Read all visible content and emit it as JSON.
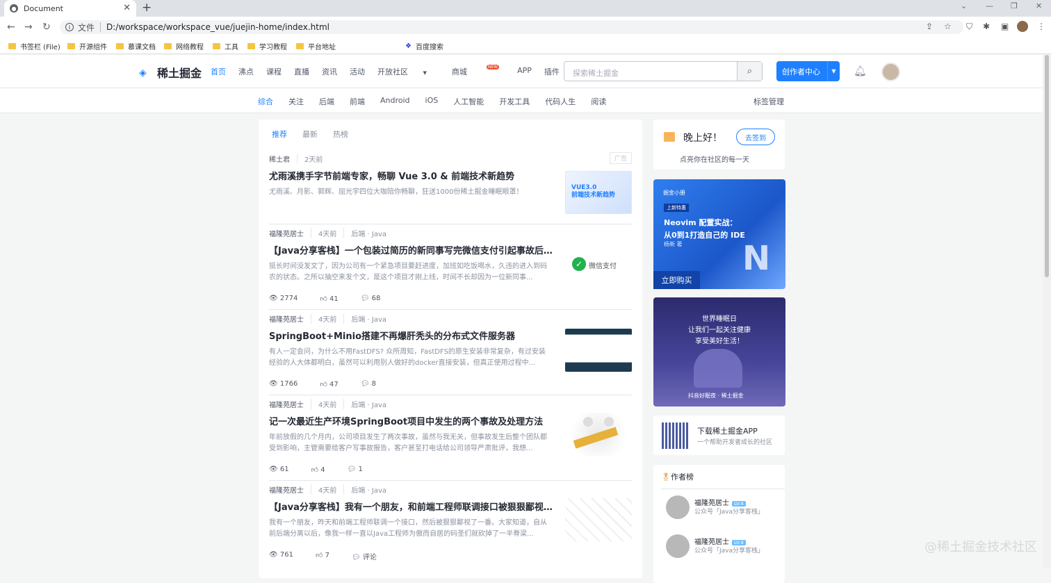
{
  "browser": {
    "tab_title": "Document",
    "url_prefix": "文件",
    "url": "D:/workspace/workspace_vue/juejin-home/index.html",
    "bookmarks": [
      "书签栏 (File)",
      "开源组件",
      "慕课文档",
      "网络教程",
      "工具",
      "学习教程",
      "平台地址",
      "百度搜索"
    ]
  },
  "header": {
    "logo": "稀土掘金",
    "nav": [
      "首页",
      "沸点",
      "课程",
      "直播",
      "资讯",
      "活动",
      "开放社区",
      "商城",
      "APP",
      "插件"
    ],
    "new_badge": "NEW",
    "search_placeholder": "探索稀土掘金",
    "creator_button": "创作者中心"
  },
  "subnav": {
    "items": [
      "综合",
      "关注",
      "后端",
      "前端",
      "Android",
      "iOS",
      "人工智能",
      "开发工具",
      "代码人生",
      "阅读"
    ],
    "tag_manage": "标签管理"
  },
  "feed": {
    "tabs": [
      "推荐",
      "最新",
      "热榜"
    ],
    "entries": [
      {
        "author": "稀土君",
        "time": "2天前",
        "tags": "",
        "ad": "广告",
        "title": "尤雨溪携手字节前端专家，畅聊 Vue 3.0 & 前端技术新趋势",
        "abstract": "尤雨溪、月影、郭辉、屈光宇四位大咖陪你畅聊，狂送1000份稀土掘金睡眠眼罩！",
        "views": "",
        "likes": "",
        "comments": ""
      },
      {
        "author": "福隆苑居士",
        "time": "4天前",
        "tags": "后端 · Java",
        "ad": "",
        "title": "【Java分享客栈】一个包装过简历的新同事写完微信支付引起事故后果...",
        "abstract": "挺长时间没发文了，因为公司有一个紧急项目要赶进度，加班如吃饭喝水，久违的进入到码农的状态。之所以抽空来发个文，是这个项目才刚上线，时间不长却因为一位新同事...",
        "views": "2774",
        "likes": "41",
        "comments": "68"
      },
      {
        "author": "福隆苑居士",
        "time": "4天前",
        "tags": "后端 · Java",
        "ad": "",
        "title": "SpringBoot+Minio搭建不再爆肝秃头的分布式文件服务器",
        "abstract": "有人一定会问，为什么不用FastDFS? 众所周知，FastDFS的原生安装非常复杂，有过安装经验的人大体都明白，虽然可以利用别人做好的docker直接安装，但真正使用过程中...",
        "views": "1766",
        "likes": "47",
        "comments": "8"
      },
      {
        "author": "福隆苑居士",
        "time": "4天前",
        "tags": "后端 · Java",
        "ad": "",
        "title": "记一次最近生产环境SpringBoot项目中发生的两个事故及处理方法",
        "abstract": "年前放假的几个月内，公司项目发生了两次事故，虽然与我无关，但事故发生后整个团队都受到影响，主管需要给客户写事故报告，客户甚至打电话给公司领导严肃批评，我想...",
        "views": "61",
        "likes": "4",
        "comments": "1"
      },
      {
        "author": "福隆苑居士",
        "time": "4天前",
        "tags": "后端 · Java",
        "ad": "",
        "title": "【Java分享客栈】我有一个朋友，和前端工程师联调接口被狠狠鄙视了...",
        "abstract": "我有一个朋友，昨天和前端工程师联调一个接口，然后被狠狠鄙视了一番。大家知道，自从前后端分离以后，像我一样一直以Java工程师为傲而自居的码圣们就砍掉了一半脊梁...",
        "views": "761",
        "likes": "7",
        "comments": "评论"
      }
    ]
  },
  "sidebar": {
    "greeting": "晚上好！",
    "sign_in": "去签到",
    "greeting_sub": "点亮你在社区的每一天",
    "ad1": {
      "brand": "掘金小册",
      "tag": "上新特惠",
      "line1": "Neovim 配置实战：",
      "line2": "从0到1打造自己的 IDE",
      "author": "杨新 著",
      "cta": "立即购买"
    },
    "ad2": {
      "line1": "世界睡眠日",
      "line2": "让我们一起关注健康",
      "line3": "享受美好生活！",
      "footer": "抖音好眠夜 · 稀土掘金"
    },
    "app_title": "下载稀土掘金APP",
    "app_sub": "一个帮助开发者成长的社区",
    "rank_title": "作者榜",
    "authors": [
      {
        "name": "福隆苑居士",
        "level": "LV.4",
        "desc": "公众号「Java分享客栈」"
      },
      {
        "name": "福隆苑居士",
        "level": "LV.4",
        "desc": "公众号「Java分享客栈」"
      }
    ]
  },
  "watermark": "@稀土掘金技术社区"
}
